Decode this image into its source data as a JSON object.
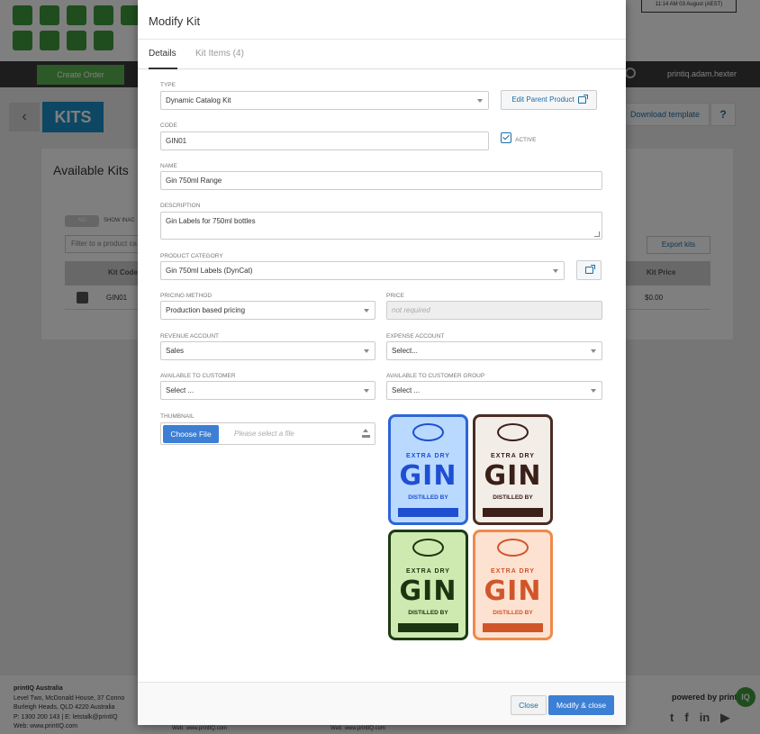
{
  "background": {
    "clock": "11:14 AM 03 August (AEST)",
    "create_order": "Create Order",
    "user": "printiq.adam.hexter",
    "page_title": "KITS",
    "download_template": "Download template",
    "help": "?",
    "panel_title": "Available Kits",
    "toggle_label": "NO",
    "show_inactive": "SHOW INAC",
    "filter_placeholder": "Filter to a product ca",
    "export_kits": "Export kits",
    "col_kit_code": "Kit Code",
    "col_kit_price": "Kit Price",
    "row_code": "GIN01",
    "row_price": "$0.00",
    "footer": {
      "company": "printIQ Australia",
      "line1": "Level Two, McDonald House, 37 Conno",
      "line2": "Burleigh Heads, QLD 4220 Australia",
      "line3": "P: 1300 200 143 | E: letstalk@printIQ",
      "web1": "Web: www.printIQ.com",
      "web2": "Web: www.printIQ.com",
      "web3": "Web: www.printIQ.com",
      "powered_by": "powered by print",
      "logo_text": "IQ"
    }
  },
  "modal": {
    "title": "Modify Kit",
    "tabs": [
      {
        "label": "Details",
        "active": true
      },
      {
        "label": "Kit Items (4)",
        "active": false
      }
    ],
    "type": {
      "label": "TYPE",
      "value": "Dynamic Catalog Kit"
    },
    "edit_parent_button": "Edit Parent Product",
    "code": {
      "label": "CODE",
      "value": "GIN01"
    },
    "active": {
      "label": "ACTIVE",
      "checked": true
    },
    "name": {
      "label": "NAME",
      "value": "Gin 750ml Range"
    },
    "description": {
      "label": "DESCRIPTION",
      "value": "Gin Labels for 750ml bottles"
    },
    "product_category": {
      "label": "PRODUCT CATEGORY",
      "value": "Gin 750ml Labels (DynCat)"
    },
    "pricing_method": {
      "label": "PRICING METHOD",
      "value": "Production based pricing"
    },
    "price": {
      "label": "PRICE",
      "placeholder": "not required"
    },
    "revenue_account": {
      "label": "REVENUE ACCOUNT",
      "value": "Sales"
    },
    "expense_account": {
      "label": "EXPENSE ACCOUNT",
      "value": "Select..."
    },
    "available_to_customer": {
      "label": "AVAILABLE TO CUSTOMER",
      "value": "Select ..."
    },
    "available_to_customer_group": {
      "label": "AVAILABLE TO CUSTOMER GROUP",
      "value": "Select ..."
    },
    "thumbnail": {
      "label": "THUMBNAIL",
      "choose_file": "Choose File",
      "placeholder": "Please select a file"
    },
    "thumbnail_labels": [
      {
        "top_text": "EXTRA DRY",
        "main_text": "GIN",
        "bottom_text": "DISTILLED BY",
        "bg": "#b9d9ff",
        "border": "#2e64d8",
        "ink": "#1f4fd1"
      },
      {
        "top_text": "EXTRA DRY",
        "main_text": "GIN",
        "bottom_text": "DISTILLED BY",
        "bg": "#f3ede8",
        "border": "#4a2d22",
        "ink": "#3a2018"
      },
      {
        "top_text": "EXTRA DRY",
        "main_text": "GIN",
        "bottom_text": "DISTILLED BY",
        "bg": "#cfeab0",
        "border": "#1e3a14",
        "ink": "#1c3510"
      },
      {
        "top_text": "EXTRA DRY",
        "main_text": "GIN",
        "bottom_text": "DISTILLED BY",
        "bg": "#fde2d2",
        "border": "#ef8a4c",
        "ink": "#d0562a"
      }
    ],
    "close_button": "Close",
    "save_button": "Modify & close"
  }
}
